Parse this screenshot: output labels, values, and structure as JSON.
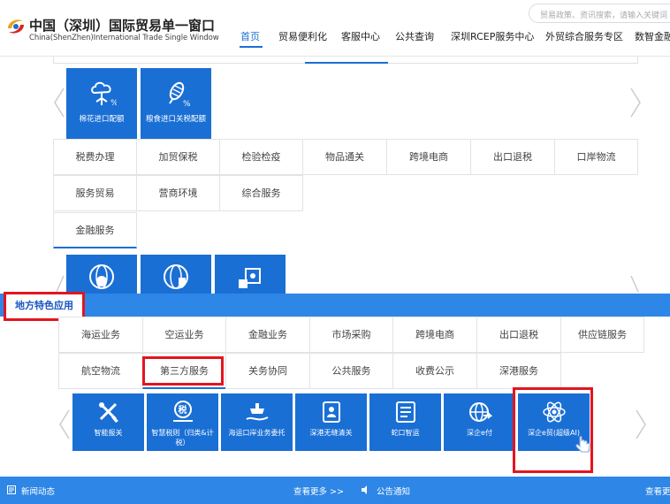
{
  "header": {
    "title": "中国（深圳）国际贸易单一窗口",
    "subtitle": "China(ShenZhen)International Trade Single Window",
    "search_placeholder": "贸易政策、资讯搜索，请输入关键词",
    "nav": [
      "首页",
      "贸易便利化",
      "客服中心",
      "公共查询",
      "深圳RCEP服务中心",
      "外贸综合服务专区",
      "数智金融"
    ],
    "active_nav": "首页",
    "accent": "#1a6fd5"
  },
  "section1": {
    "tiles": [
      "棉花进口配额",
      "粮食进口关税配额"
    ],
    "tabs_row1": [
      "税费办理",
      "加贸保税",
      "检验检疫",
      "物品通关",
      "跨境电商",
      "出口退税",
      "口岸物流"
    ],
    "tabs_row2": [
      "服务贸易",
      "营商环境",
      "综合服务"
    ],
    "tabs_row3": [
      "金融服务"
    ],
    "selected_tab": "金融服务",
    "partial_tile_icons": [
      "globe-yen-icon",
      "globe-shield-icon",
      "safe-box-icon"
    ]
  },
  "local": {
    "heading": "地方特色应用",
    "tabs_row1": [
      "海运业务",
      "空运业务",
      "金融业务",
      "市场采购",
      "跨境电商",
      "出口退税",
      "供应链服务"
    ],
    "tabs_row2": [
      "航空物流",
      "第三方服务",
      "关务协同",
      "公共服务",
      "收费公示",
      "深港服务"
    ],
    "selected_tab": "第三方服务",
    "tiles": [
      "智能报关",
      "智慧税则（归类&计税）",
      "海运口岸业务委托",
      "深港无缝清关",
      "蛇口智运",
      "深企e付",
      "深企e贸(超级AI)"
    ],
    "highlight_color": "#e3151f"
  },
  "footer": {
    "news": "新闻动态",
    "more": "查看更多 >>",
    "notice": "公告通知",
    "more2": "查看更"
  }
}
